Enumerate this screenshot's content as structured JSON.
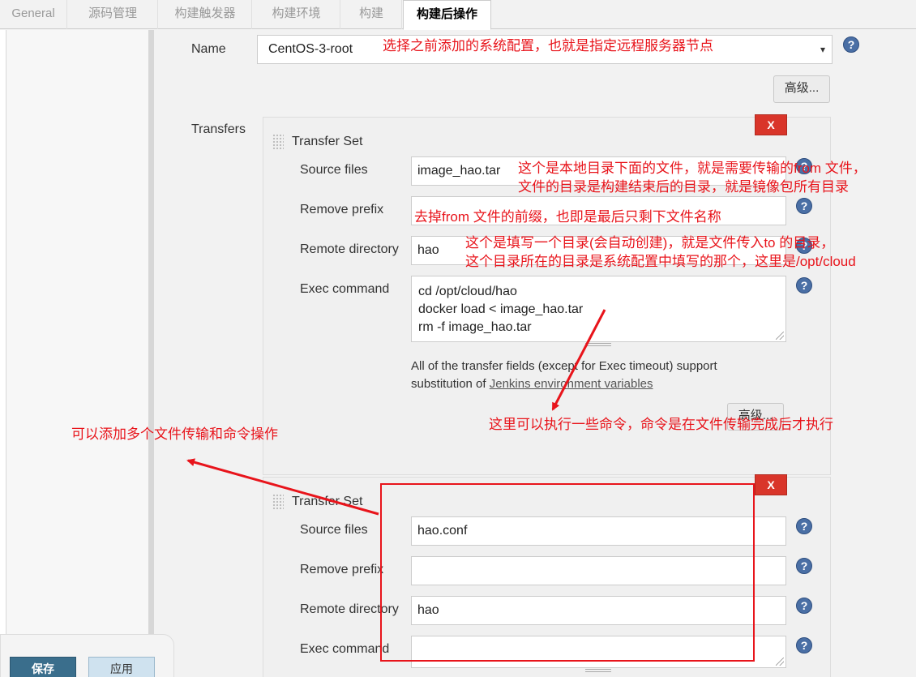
{
  "tabs": [
    {
      "label": "General"
    },
    {
      "label": "源码管理"
    },
    {
      "label": "构建触发器"
    },
    {
      "label": "构建环境"
    },
    {
      "label": "构建"
    },
    {
      "label": "构建后操作"
    }
  ],
  "server": {
    "name_label": "Name",
    "name_value": "CentOS-3-root",
    "advanced_label": "高级..."
  },
  "transfers_label": "Transfers",
  "help_glyph": "?",
  "dropdown_glyph": "▾",
  "transfer_sets": [
    {
      "title": "Transfer Set",
      "remove_label": "X",
      "source_files_label": "Source files",
      "source_files_value": "image_hao.tar",
      "remove_prefix_label": "Remove prefix",
      "remove_prefix_value": "",
      "remote_directory_label": "Remote directory",
      "remote_directory_value": "hao",
      "exec_command_label": "Exec command",
      "exec_command_lines": [
        "cd /opt/cloud/hao",
        "docker load < image_hao.tar",
        "rm -f image_hao.tar"
      ],
      "note_text_1": "All of the transfer fields (except for Exec timeout) support",
      "note_text_2": "substitution of ",
      "note_link": "Jenkins environment variables",
      "advanced_label": "高级..."
    },
    {
      "title": "Transfer Set",
      "remove_label": "X",
      "source_files_label": "Source files",
      "source_files_value": "hao.conf",
      "remove_prefix_label": "Remove prefix",
      "remove_prefix_value": "",
      "remote_directory_label": "Remote directory",
      "remote_directory_value": "hao",
      "exec_command_label": "Exec command",
      "exec_command_lines": []
    }
  ],
  "annotations": {
    "name_note": "选择之前添加的系统配置，也就是指定远程服务器节点",
    "source_note_1": "这个是本地目录下面的文件，就是需要传输的from 文件，",
    "source_note_2": "文件的目录是构建结束后的目录，就是镜像包所有目录",
    "prefix_note": "去掉from 文件的前缀，也即是最后只剩下文件名称",
    "remote_note_1": "这个是填写一个目录(会自动创建)，就是文件传入to 的目录，",
    "remote_note_2": "这个目录所在的目录是系统配置中填写的那个，这里是/opt/cloud",
    "exec_note": "这里可以执行一些命令，命令是在文件传输完成后才执行",
    "multi_note": "可以添加多个文件传输和命令操作"
  },
  "footer": {
    "save_label": "保存",
    "apply_label": "应用"
  },
  "colors": {
    "annotation": "#e8141b",
    "help_icon": "#4a6fa5",
    "remove_button": "#d9352a",
    "save_button": "#3a6e8c"
  }
}
